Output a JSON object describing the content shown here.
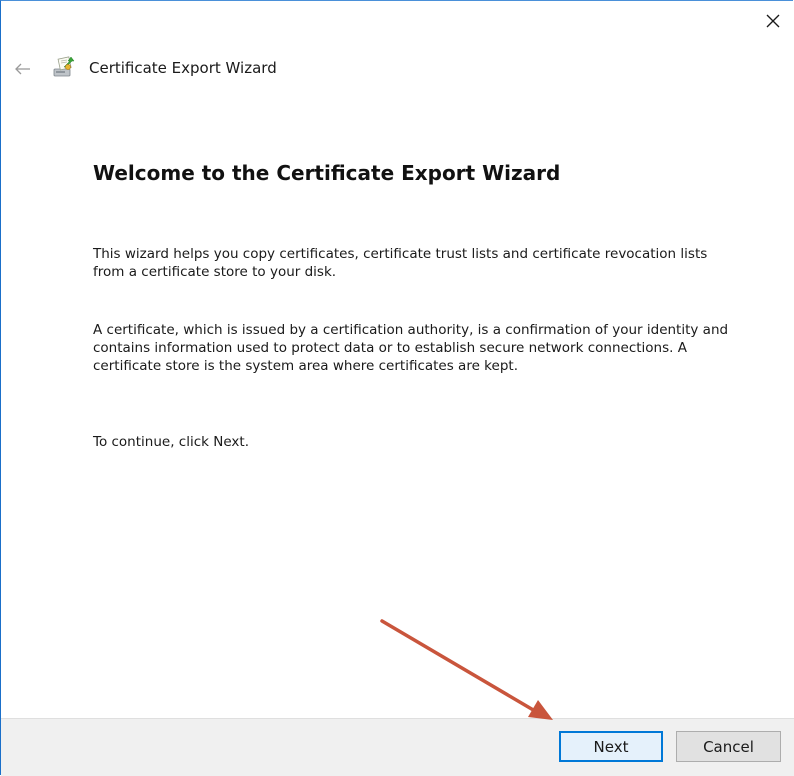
{
  "window": {
    "title": "Certificate Export Wizard",
    "accent_color": "#0078d7",
    "annotation_arrow_color": "#c9553c"
  },
  "icons": {
    "close": "close-icon",
    "back": "back-arrow-icon",
    "wizard": "certificate-wizard-icon"
  },
  "content": {
    "heading": "Welcome to the Certificate Export Wizard",
    "paragraph1": "This wizard helps you copy certificates, certificate trust lists and certificate revocation lists from a certificate store to your disk.",
    "paragraph2": "A certificate, which is issued by a certification authority, is a confirmation of your identity and contains information used to protect data or to establish secure network connections. A certificate store is the system area where certificates are kept.",
    "paragraph3": "To continue, click Next."
  },
  "footer": {
    "next_label": "Next",
    "cancel_label": "Cancel"
  }
}
